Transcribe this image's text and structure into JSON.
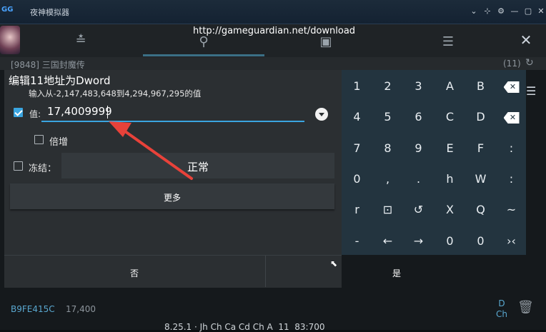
{
  "window": {
    "logo": "GG",
    "title": "夜神模拟器",
    "controls": [
      "⌄",
      "⊹",
      "⚙",
      "—",
      "▢",
      "✕"
    ]
  },
  "toolbar": {
    "url": "http://gameguardian.net/download",
    "icons": [
      "settings-sliders-icon",
      "search-icon",
      "save-icon",
      "list-icon",
      "close-icon"
    ],
    "icon_glyphs": [
      "≛",
      "⚲",
      "▣",
      "☰",
      "✕"
    ]
  },
  "process": {
    "name": "[9848] 三国封魔传",
    "count": "(11)",
    "refresh_glyph": "↻"
  },
  "dialog": {
    "title": "编辑11地址为Dword",
    "hint": "输入从-2,147,483,648到4,294,967,295的值",
    "value_label": "值:",
    "value": "17,4009999",
    "value_checked": true,
    "multiply_label": "倍增",
    "multiply_checked": false,
    "freeze_label": "冻结：",
    "freeze_checked": false,
    "freeze_mode": "正常",
    "more_label": "更多",
    "no_label": "否",
    "yes_label": "是"
  },
  "keypad": {
    "rows": [
      [
        "1",
        "2",
        "3",
        "A",
        "B",
        "⌫"
      ],
      [
        "4",
        "5",
        "6",
        "C",
        "D",
        "⌫"
      ],
      [
        "7",
        "8",
        "9",
        "E",
        "F",
        ":"
      ],
      [
        "0",
        ",",
        ".",
        "h",
        "W",
        ":"
      ],
      [
        "r",
        "⊡",
        "↺",
        "X",
        "Q",
        "~"
      ],
      [
        "-",
        "←",
        "→",
        "0",
        "0",
        "›‹"
      ]
    ]
  },
  "background": {
    "address": "B9FE415C",
    "value": "17,400",
    "type_lines": [
      "D",
      "Ch"
    ],
    "menu_glyph": "☰",
    "trash_glyph": "🗑",
    "status": "8.25.1 · Jh Ch Ca Cd Ch A  11  83:700"
  },
  "colors": {
    "accent": "#3aa5e0",
    "keypad_bg": "#23343f",
    "dialog_bg": "#2b2f32",
    "arrow": "#e8423a"
  }
}
